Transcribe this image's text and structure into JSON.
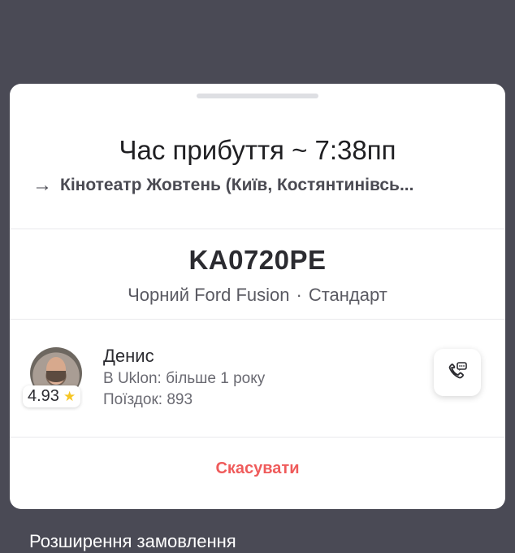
{
  "trip": {
    "eta": "Час прибуття ~ 7:38пп",
    "destination": "Кінотеатр Жовтень (Київ, Костянтинівсь..."
  },
  "vehicle": {
    "plate": "KA0720PE",
    "description": "Чорний Ford Fusion",
    "separator": "·",
    "tariff": "Стандарт"
  },
  "driver": {
    "name": "Денис",
    "tenure": "В Uklon: більше 1 року",
    "trips": "Поїздок: 893",
    "rating": "4.93"
  },
  "actions": {
    "cancel_label": "Скасувати"
  },
  "footer": {
    "label": "Розширення замовлення"
  },
  "icons": {
    "arrow": "arrow-right-icon",
    "star": "star-icon",
    "call": "phone-chat-icon"
  },
  "colors": {
    "backdrop": "#4a4a55",
    "cancel": "#ef5b5b",
    "star": "#f6c624"
  }
}
